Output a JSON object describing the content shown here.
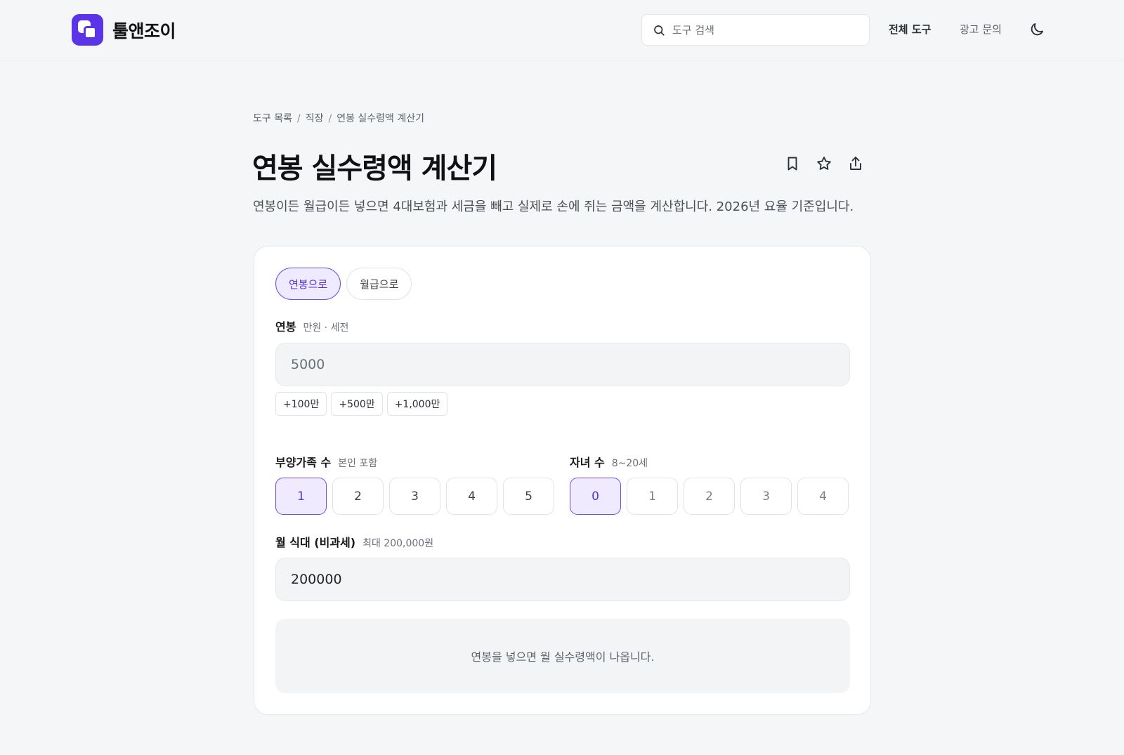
{
  "app": {
    "name": "툴앤조이",
    "brand_color": "#5b34e8"
  },
  "header": {
    "search_placeholder": "도구 검색",
    "nav_all_tools": "전체 도구",
    "nav_ad_inquiry": "광고 문의",
    "theme_icon": "moon-icon"
  },
  "breadcrumb": {
    "items": [
      "도구 목록",
      "직장",
      "연봉 실수령액 계산기"
    ],
    "separator": "/"
  },
  "page": {
    "title": "연봉 실수령액 계산기",
    "description": "연봉이든 월급이든 넣으면 4대보험과 세금을 빼고 실제로 손에 쥐는 금액을 계산합니다. 2026년 요율 기준입니다.",
    "action_icons": [
      "bookmark-icon",
      "star-icon",
      "share-icon"
    ]
  },
  "calculator": {
    "mode_tabs": [
      {
        "label": "연봉으로",
        "active": true
      },
      {
        "label": "월급으로",
        "active": false
      }
    ],
    "salary": {
      "label": "연봉",
      "hint": "만원 · 세전",
      "placeholder": "5000",
      "value": ""
    },
    "quick_add": [
      "+100만",
      "+500만",
      "+1,000만"
    ],
    "dependents": {
      "label": "부양가족 수",
      "hint": "본인 포함",
      "options": [
        "1",
        "2",
        "3",
        "4",
        "5"
      ],
      "selected": "1"
    },
    "children": {
      "label": "자녀 수",
      "hint": "8~20세",
      "options": [
        "0",
        "1",
        "2",
        "3",
        "4"
      ],
      "selected": "0"
    },
    "meal": {
      "label": "월 식대 (비과세)",
      "hint": "최대 200,000원",
      "value": "200000"
    },
    "result_message": "연봉을 넣으면 월 실수령액이 나옵니다."
  },
  "colors": {
    "accent": "#5431d9",
    "accent_bg": "#efeafd",
    "page_bg": "#f5f6f8"
  }
}
